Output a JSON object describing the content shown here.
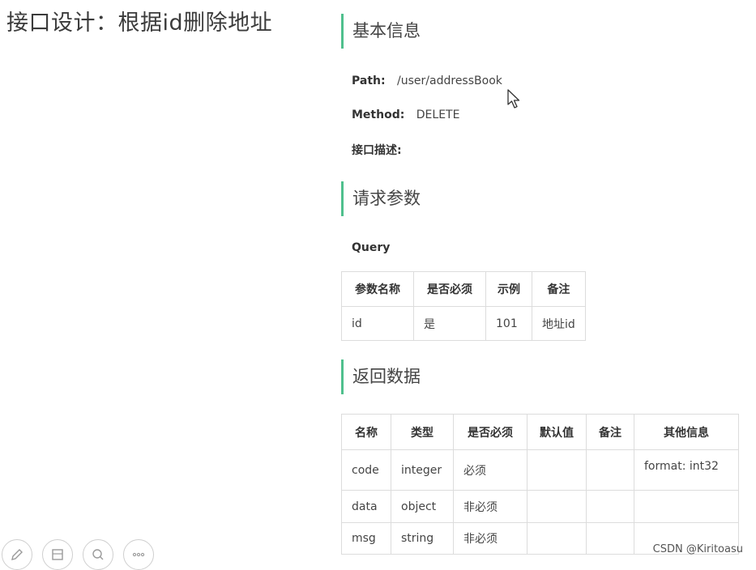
{
  "slide": {
    "title": "接口设计：根据id删除地址"
  },
  "basic_info": {
    "heading": "基本信息",
    "path_label": "Path:",
    "path_value": "/user/addressBook",
    "method_label": "Method:",
    "method_value": "DELETE",
    "desc_label": "接口描述:"
  },
  "request": {
    "heading": "请求参数",
    "query_label": "Query",
    "columns": [
      "参数名称",
      "是否必须",
      "示例",
      "备注"
    ],
    "rows": [
      [
        "id",
        "是",
        "101",
        "地址id"
      ]
    ]
  },
  "response": {
    "heading": "返回数据",
    "columns": [
      "名称",
      "类型",
      "是否必须",
      "默认值",
      "备注",
      "其他信息"
    ],
    "rows": [
      [
        "code",
        "integer",
        "必须",
        "",
        "",
        "format: int32"
      ],
      [
        "data",
        "object",
        "非必须",
        "",
        "",
        ""
      ],
      [
        "msg",
        "string",
        "非必须",
        "",
        "",
        ""
      ]
    ]
  },
  "watermark": "CSDN @Kiritoasu",
  "toolbar": {
    "icons": [
      "pen-icon",
      "slides-icon",
      "zoom-icon",
      "more-icon"
    ]
  },
  "colors": {
    "accent": "#4fc08d",
    "border": "#dcdcdc"
  }
}
